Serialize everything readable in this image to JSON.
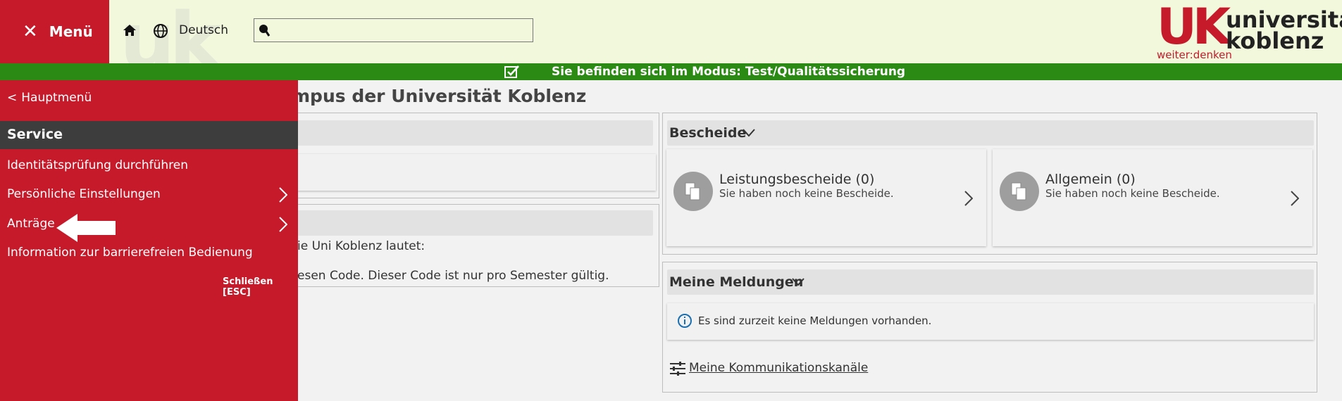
{
  "header": {
    "menu_label": "Menü",
    "language": "Deutsch",
    "search": {
      "value": "",
      "placeholder": ""
    },
    "logo": {
      "mark": "UK",
      "name_line1": "universität",
      "name_line2": "koblenz",
      "tagline": "weiter:denken"
    }
  },
  "mode_bar": {
    "text": "Sie befinden sich im Modus: Test/Qualitätssicherung"
  },
  "main": {
    "title": "mpus der Universität Koblenz",
    "left_box": {
      "text1": "ie Uni Koblenz lautet:",
      "text2": "esen Code. Dieser Code ist nur pro Semester gültig."
    },
    "bescheide": {
      "title": "Bescheide",
      "cards": [
        {
          "title": "Leistungsbescheide (0)",
          "subtitle": "Sie haben noch keine Bescheide."
        },
        {
          "title": "Allgemein (0)",
          "subtitle": "Sie haben noch keine Bescheide."
        }
      ]
    },
    "meldungen": {
      "title": "Meine Meldungen",
      "info": "Es sind zurzeit keine Meldungen vorhanden.",
      "channels_link": "Meine Kommunikationskanäle"
    }
  },
  "side_menu": {
    "back_label": "Hauptmenü",
    "section": "Service",
    "items": [
      {
        "label": "Identitätsprüfung durchführen"
      },
      {
        "label": "Persönliche Einstellungen"
      },
      {
        "label": "Anträge"
      },
      {
        "label": "Information zur barrierefreien Bedienung"
      }
    ],
    "close_label": "Schließen [ESC]"
  },
  "colors": {
    "brand_red": "#c61a2b",
    "mode_green": "#2b8a13",
    "header_bg": "#f1f8dc",
    "menu_dark": "#3d3d3d"
  }
}
